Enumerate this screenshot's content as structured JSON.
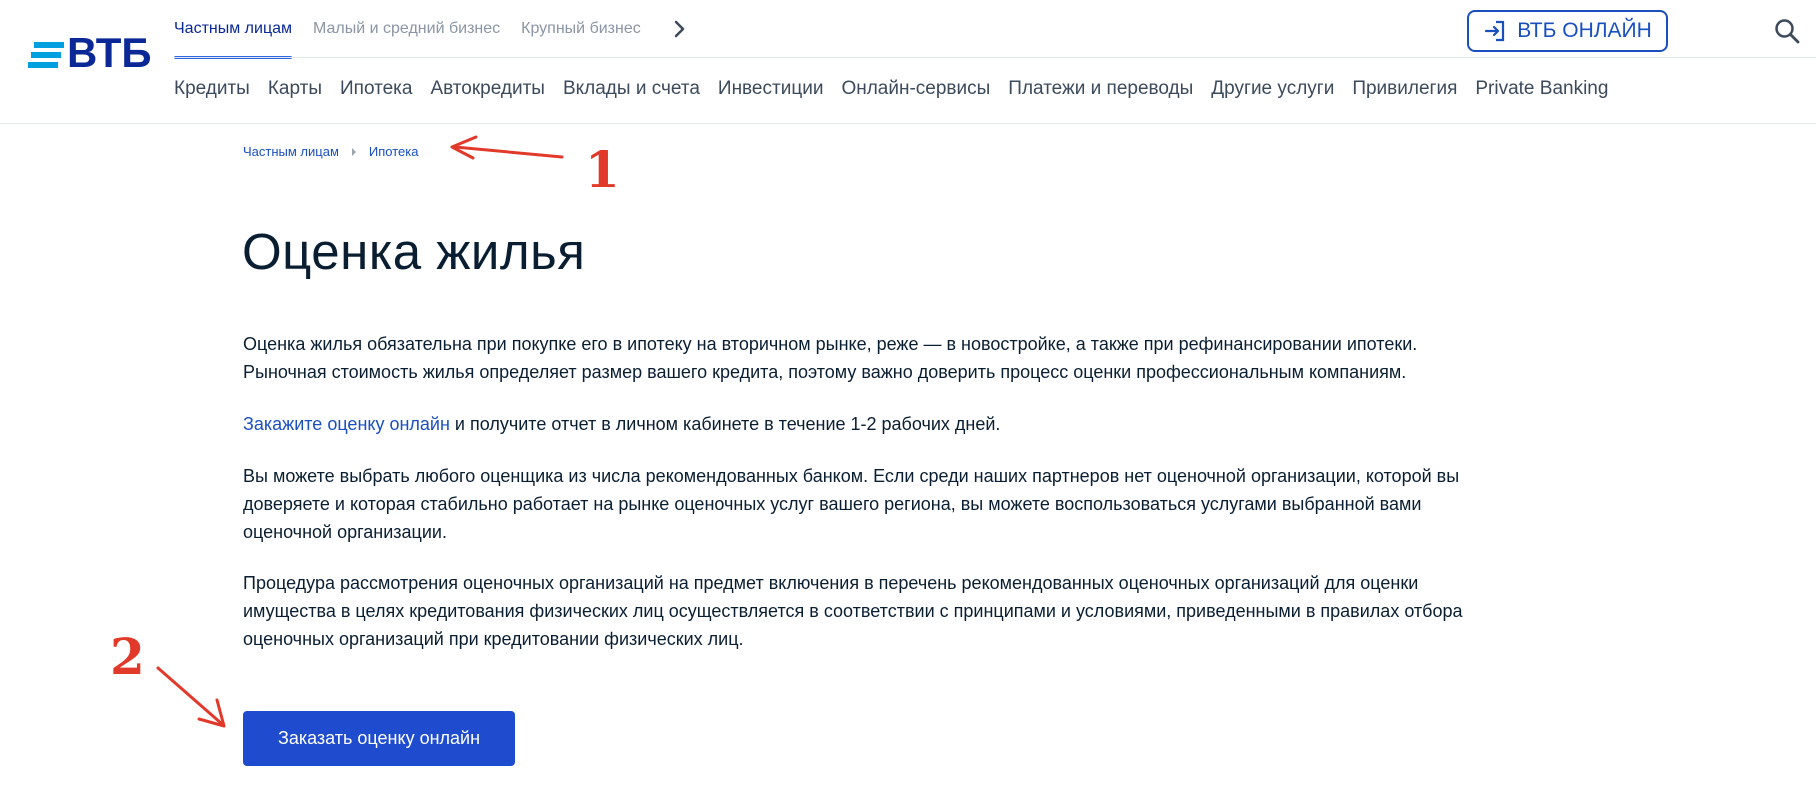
{
  "brand": {
    "logo_text": "ВТБ",
    "accent": "#1a4fc0",
    "button_bg": "#1f4bce",
    "annotation_color": "#e13a2b"
  },
  "header": {
    "segments": [
      {
        "label": "Частным лицам",
        "active": true
      },
      {
        "label": "Малый и средний бизнес",
        "active": false
      },
      {
        "label": "Крупный бизнес",
        "active": false
      }
    ],
    "online_button": "ВТБ ОНЛАЙН",
    "nav": [
      "Кредиты",
      "Карты",
      "Ипотека",
      "Автокредиты",
      "Вклады и счета",
      "Инвестиции",
      "Онлайн-сервисы",
      "Платежи и переводы",
      "Другие услуги",
      "Привилегия",
      "Private Banking"
    ]
  },
  "breadcrumb": [
    "Частным лицам",
    "Ипотека"
  ],
  "page": {
    "title": "Оценка жилья",
    "p1_line1": "Оценка жилья обязательна при покупке его в ипотеку на вторичном рынке, реже — в новостройке, а также при рефинансировании ипотеки.",
    "p1_line2": "Рыночная стоимость жилья определяет размер вашего кредита, поэтому важно доверить процесс оценки профессиональным компаниям.",
    "p2_link": "Закажите оценку онлайн",
    "p2_rest": " и получите отчет в личном кабинете в течение 1-2 рабочих дней.",
    "p3_line1": "Вы можете выбрать любого оценщика из числа рекомендованных банком. Если среди наших партнеров нет оценочной организации, которой вы",
    "p3_line2": "доверяете и которая стабильно работает на рынке оценочных услуг вашего региона, вы можете воспользоваться услугами выбранной вами",
    "p3_line3": "оценочной организации.",
    "p4_line1": "Процедура рассмотрения оценочных организаций на предмет включения в перечень рекомендованных оценочных организаций для оценки",
    "p4_line2": "имущества в целях кредитования физических лиц осуществляется в соответствии с принципами и условиями, приведенными в правилах отбора",
    "p4_line3": "оценочных организаций при кредитовании физических лиц.",
    "order_button": "Заказать оценку онлайн"
  },
  "annotations": {
    "label1": "1",
    "label2": "2"
  },
  "icons": {
    "search": "search-icon",
    "login": "login-icon",
    "next": "chevron-right-icon",
    "sep": "chevron-right-small-icon"
  }
}
